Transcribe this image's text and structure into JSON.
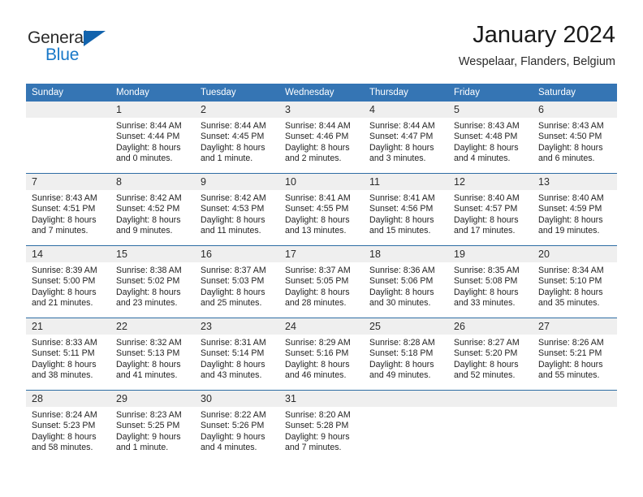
{
  "brand": {
    "name_part1": "General",
    "name_part2": "Blue",
    "triangle_color": "#1263ad",
    "blue_color": "#1878c8"
  },
  "header": {
    "title": "January 2024",
    "subtitle": "Wespelaar, Flanders, Belgium"
  },
  "theme": {
    "header_bar_color": "#3575b4",
    "week_divider_color": "#2e6da4",
    "date_band_color": "#efefef"
  },
  "weekday_headers": [
    "Sunday",
    "Monday",
    "Tuesday",
    "Wednesday",
    "Thursday",
    "Friday",
    "Saturday"
  ],
  "weeks": [
    [
      {
        "day": "",
        "empty": true,
        "sunrise": "",
        "sunset": "",
        "daylight_line1": "",
        "daylight_line2": ""
      },
      {
        "day": "1",
        "sunrise": "Sunrise: 8:44 AM",
        "sunset": "Sunset: 4:44 PM",
        "daylight_line1": "Daylight: 8 hours",
        "daylight_line2": "and 0 minutes."
      },
      {
        "day": "2",
        "sunrise": "Sunrise: 8:44 AM",
        "sunset": "Sunset: 4:45 PM",
        "daylight_line1": "Daylight: 8 hours",
        "daylight_line2": "and 1 minute."
      },
      {
        "day": "3",
        "sunrise": "Sunrise: 8:44 AM",
        "sunset": "Sunset: 4:46 PM",
        "daylight_line1": "Daylight: 8 hours",
        "daylight_line2": "and 2 minutes."
      },
      {
        "day": "4",
        "sunrise": "Sunrise: 8:44 AM",
        "sunset": "Sunset: 4:47 PM",
        "daylight_line1": "Daylight: 8 hours",
        "daylight_line2": "and 3 minutes."
      },
      {
        "day": "5",
        "sunrise": "Sunrise: 8:43 AM",
        "sunset": "Sunset: 4:48 PM",
        "daylight_line1": "Daylight: 8 hours",
        "daylight_line2": "and 4 minutes."
      },
      {
        "day": "6",
        "sunrise": "Sunrise: 8:43 AM",
        "sunset": "Sunset: 4:50 PM",
        "daylight_line1": "Daylight: 8 hours",
        "daylight_line2": "and 6 minutes."
      }
    ],
    [
      {
        "day": "7",
        "sunrise": "Sunrise: 8:43 AM",
        "sunset": "Sunset: 4:51 PM",
        "daylight_line1": "Daylight: 8 hours",
        "daylight_line2": "and 7 minutes."
      },
      {
        "day": "8",
        "sunrise": "Sunrise: 8:42 AM",
        "sunset": "Sunset: 4:52 PM",
        "daylight_line1": "Daylight: 8 hours",
        "daylight_line2": "and 9 minutes."
      },
      {
        "day": "9",
        "sunrise": "Sunrise: 8:42 AM",
        "sunset": "Sunset: 4:53 PM",
        "daylight_line1": "Daylight: 8 hours",
        "daylight_line2": "and 11 minutes."
      },
      {
        "day": "10",
        "sunrise": "Sunrise: 8:41 AM",
        "sunset": "Sunset: 4:55 PM",
        "daylight_line1": "Daylight: 8 hours",
        "daylight_line2": "and 13 minutes."
      },
      {
        "day": "11",
        "sunrise": "Sunrise: 8:41 AM",
        "sunset": "Sunset: 4:56 PM",
        "daylight_line1": "Daylight: 8 hours",
        "daylight_line2": "and 15 minutes."
      },
      {
        "day": "12",
        "sunrise": "Sunrise: 8:40 AM",
        "sunset": "Sunset: 4:57 PM",
        "daylight_line1": "Daylight: 8 hours",
        "daylight_line2": "and 17 minutes."
      },
      {
        "day": "13",
        "sunrise": "Sunrise: 8:40 AM",
        "sunset": "Sunset: 4:59 PM",
        "daylight_line1": "Daylight: 8 hours",
        "daylight_line2": "and 19 minutes."
      }
    ],
    [
      {
        "day": "14",
        "sunrise": "Sunrise: 8:39 AM",
        "sunset": "Sunset: 5:00 PM",
        "daylight_line1": "Daylight: 8 hours",
        "daylight_line2": "and 21 minutes."
      },
      {
        "day": "15",
        "sunrise": "Sunrise: 8:38 AM",
        "sunset": "Sunset: 5:02 PM",
        "daylight_line1": "Daylight: 8 hours",
        "daylight_line2": "and 23 minutes."
      },
      {
        "day": "16",
        "sunrise": "Sunrise: 8:37 AM",
        "sunset": "Sunset: 5:03 PM",
        "daylight_line1": "Daylight: 8 hours",
        "daylight_line2": "and 25 minutes."
      },
      {
        "day": "17",
        "sunrise": "Sunrise: 8:37 AM",
        "sunset": "Sunset: 5:05 PM",
        "daylight_line1": "Daylight: 8 hours",
        "daylight_line2": "and 28 minutes."
      },
      {
        "day": "18",
        "sunrise": "Sunrise: 8:36 AM",
        "sunset": "Sunset: 5:06 PM",
        "daylight_line1": "Daylight: 8 hours",
        "daylight_line2": "and 30 minutes."
      },
      {
        "day": "19",
        "sunrise": "Sunrise: 8:35 AM",
        "sunset": "Sunset: 5:08 PM",
        "daylight_line1": "Daylight: 8 hours",
        "daylight_line2": "and 33 minutes."
      },
      {
        "day": "20",
        "sunrise": "Sunrise: 8:34 AM",
        "sunset": "Sunset: 5:10 PM",
        "daylight_line1": "Daylight: 8 hours",
        "daylight_line2": "and 35 minutes."
      }
    ],
    [
      {
        "day": "21",
        "sunrise": "Sunrise: 8:33 AM",
        "sunset": "Sunset: 5:11 PM",
        "daylight_line1": "Daylight: 8 hours",
        "daylight_line2": "and 38 minutes."
      },
      {
        "day": "22",
        "sunrise": "Sunrise: 8:32 AM",
        "sunset": "Sunset: 5:13 PM",
        "daylight_line1": "Daylight: 8 hours",
        "daylight_line2": "and 41 minutes."
      },
      {
        "day": "23",
        "sunrise": "Sunrise: 8:31 AM",
        "sunset": "Sunset: 5:14 PM",
        "daylight_line1": "Daylight: 8 hours",
        "daylight_line2": "and 43 minutes."
      },
      {
        "day": "24",
        "sunrise": "Sunrise: 8:29 AM",
        "sunset": "Sunset: 5:16 PM",
        "daylight_line1": "Daylight: 8 hours",
        "daylight_line2": "and 46 minutes."
      },
      {
        "day": "25",
        "sunrise": "Sunrise: 8:28 AM",
        "sunset": "Sunset: 5:18 PM",
        "daylight_line1": "Daylight: 8 hours",
        "daylight_line2": "and 49 minutes."
      },
      {
        "day": "26",
        "sunrise": "Sunrise: 8:27 AM",
        "sunset": "Sunset: 5:20 PM",
        "daylight_line1": "Daylight: 8 hours",
        "daylight_line2": "and 52 minutes."
      },
      {
        "day": "27",
        "sunrise": "Sunrise: 8:26 AM",
        "sunset": "Sunset: 5:21 PM",
        "daylight_line1": "Daylight: 8 hours",
        "daylight_line2": "and 55 minutes."
      }
    ],
    [
      {
        "day": "28",
        "sunrise": "Sunrise: 8:24 AM",
        "sunset": "Sunset: 5:23 PM",
        "daylight_line1": "Daylight: 8 hours",
        "daylight_line2": "and 58 minutes."
      },
      {
        "day": "29",
        "sunrise": "Sunrise: 8:23 AM",
        "sunset": "Sunset: 5:25 PM",
        "daylight_line1": "Daylight: 9 hours",
        "daylight_line2": "and 1 minute."
      },
      {
        "day": "30",
        "sunrise": "Sunrise: 8:22 AM",
        "sunset": "Sunset: 5:26 PM",
        "daylight_line1": "Daylight: 9 hours",
        "daylight_line2": "and 4 minutes."
      },
      {
        "day": "31",
        "sunrise": "Sunrise: 8:20 AM",
        "sunset": "Sunset: 5:28 PM",
        "daylight_line1": "Daylight: 9 hours",
        "daylight_line2": "and 7 minutes."
      },
      {
        "day": "",
        "empty": true,
        "sunrise": "",
        "sunset": "",
        "daylight_line1": "",
        "daylight_line2": ""
      },
      {
        "day": "",
        "empty": true,
        "sunrise": "",
        "sunset": "",
        "daylight_line1": "",
        "daylight_line2": ""
      },
      {
        "day": "",
        "empty": true,
        "sunrise": "",
        "sunset": "",
        "daylight_line1": "",
        "daylight_line2": ""
      }
    ]
  ]
}
